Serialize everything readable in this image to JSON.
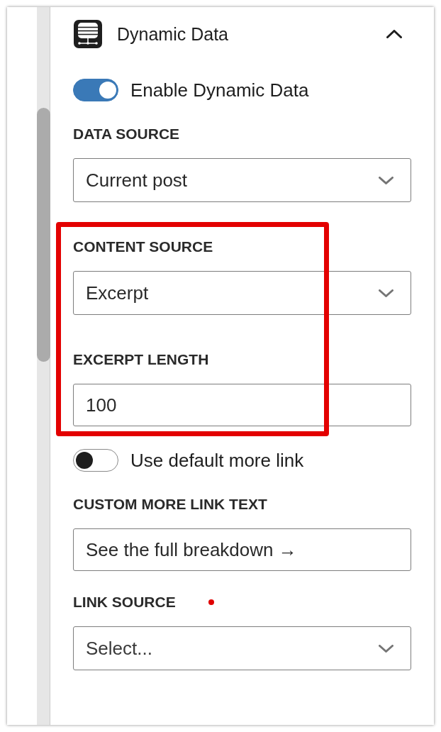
{
  "panel": {
    "title": "Dynamic Data",
    "expanded": true
  },
  "controls": [
    {
      "kind": "toggle",
      "label": "Enable Dynamic Data",
      "on": true,
      "highlighted": false,
      "marked": false
    },
    {
      "kind": "select",
      "label": "DATA SOURCE",
      "value": "Current post",
      "highlighted": false,
      "marked": false
    },
    {
      "kind": "select",
      "label": "CONTENT SOURCE",
      "value": "Excerpt",
      "highlighted": true,
      "marked": false
    },
    {
      "kind": "text",
      "label": "EXCERPT LENGTH",
      "value": "100",
      "highlighted": true,
      "marked": false
    },
    {
      "kind": "toggle",
      "label": "Use default more link",
      "on": false,
      "highlighted": false,
      "marked": false
    },
    {
      "kind": "text",
      "label": "CUSTOM MORE LINK TEXT",
      "value": "See the full breakdown →",
      "highlighted": false,
      "marked": false
    },
    {
      "kind": "select",
      "label": "LINK SOURCE",
      "placeholder": "Select...",
      "highlighted": false,
      "marked": true
    }
  ]
}
